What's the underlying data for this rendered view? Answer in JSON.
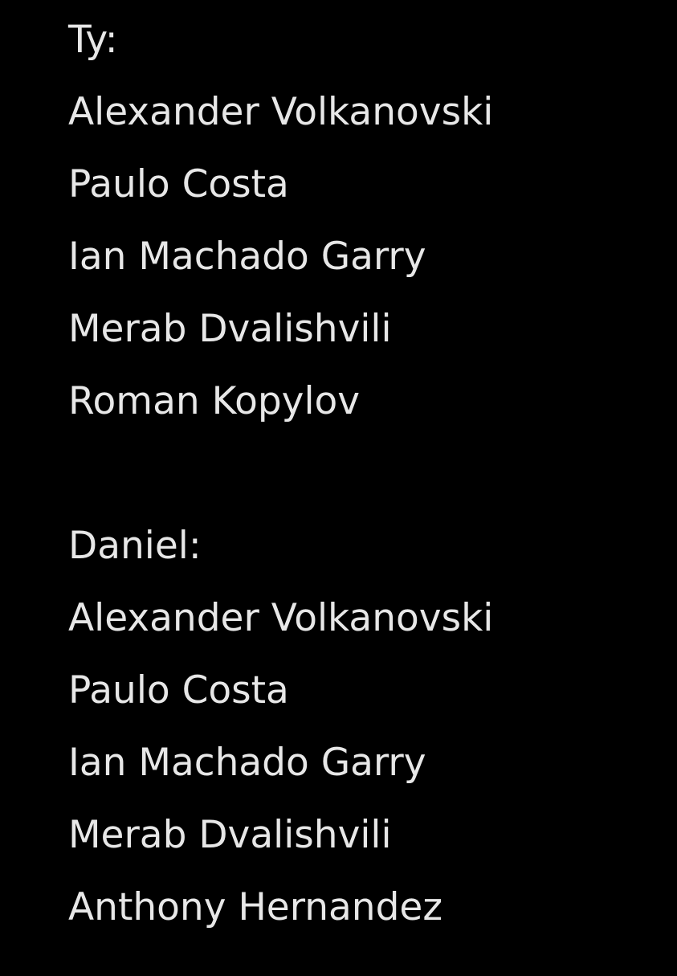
{
  "note": {
    "sections": [
      {
        "heading": "Ty:",
        "items": [
          "Alexander Volkanovski",
          "Paulo Costa",
          "Ian Machado Garry",
          "Merab Dvalishvili",
          "Roman Kopylov"
        ]
      },
      {
        "heading": "Daniel:",
        "items": [
          "Alexander Volkanovski",
          "Paulo Costa",
          "Ian Machado Garry",
          "Merab Dvalishvili",
          "Anthony Hernandez"
        ]
      }
    ]
  },
  "colors": {
    "background": "#000000",
    "text": "#e7e7e7"
  }
}
